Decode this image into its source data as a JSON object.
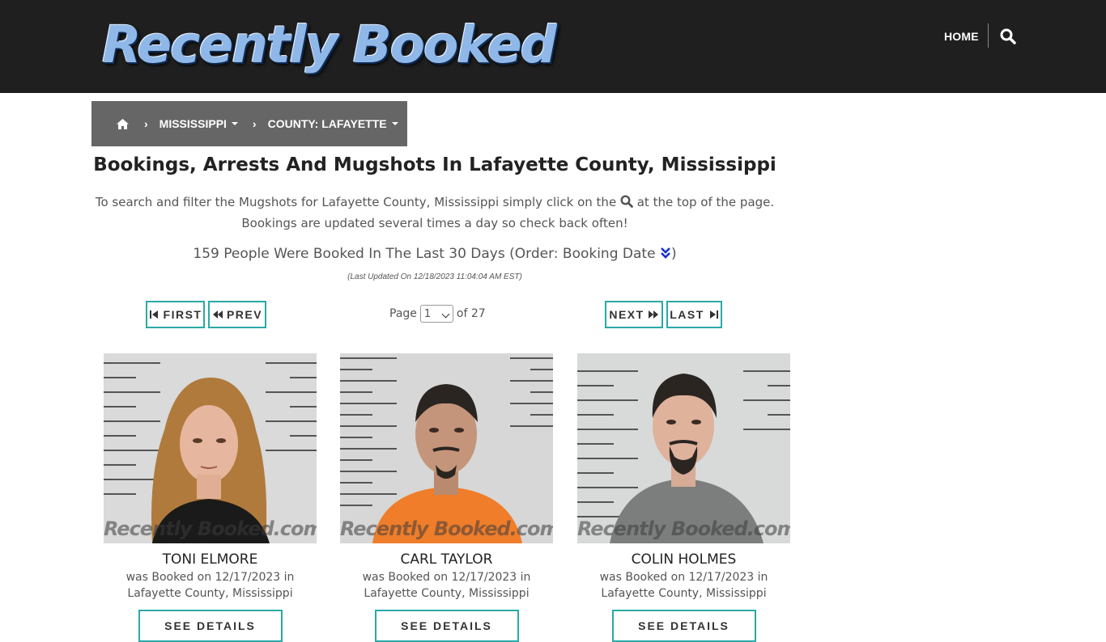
{
  "header": {
    "logo_text": "Recently Booked",
    "nav": {
      "home_label": "HOME"
    },
    "search_icon": "search-icon"
  },
  "breadcrumb": {
    "home_icon": "home-icon",
    "items": [
      {
        "label": "MISSISSIPPI"
      },
      {
        "label": "COUNTY: LAFAYETTE"
      }
    ]
  },
  "main": {
    "title": "Bookings, Arrests And Mugshots In Lafayette County, Mississippi",
    "intro_part1": "To search and filter the Mugshots for Lafayette County, Mississippi simply click on the",
    "intro_part2": "at the top of the page.",
    "intro_line2": "Bookings are updated several times a day so check back often!",
    "count_text": "159 People Were Booked In The Last 30 Days (Order: Booking Date",
    "count_close": ")",
    "updated": "(Last Updated On 12/18/2023 11:04:04 AM EST)"
  },
  "pagination": {
    "first_label": "FIRST",
    "prev_label": "PREV",
    "next_label": "NEXT",
    "last_label": "LAST",
    "page_label": "Page",
    "current_page": "1",
    "of_label": "of 27"
  },
  "watermark": "Recently Booked.com",
  "inmates": [
    {
      "name": "TONI ELMORE",
      "booked_line": "was Booked on 12/17/2023 in",
      "location": "Lafayette County, Mississippi",
      "details_label": "SEE DETAILS",
      "shirt_color": "#1a1a1a",
      "hair_color": "#b07a3c",
      "bg_color": "#d9dad9"
    },
    {
      "name": "CARL TAYLOR",
      "booked_line": "was Booked on 12/17/2023 in",
      "location": "Lafayette County, Mississippi",
      "details_label": "SEE DETAILS",
      "shirt_color": "#f07d2a",
      "hair_color": "#2a2520",
      "bg_color": "#d6d7d6"
    },
    {
      "name": "COLIN HOLMES",
      "booked_line": "was Booked on 12/17/2023 in",
      "location": "Lafayette County, Mississippi",
      "details_label": "SEE DETAILS",
      "shirt_color": "#7b7e7c",
      "hair_color": "#2b2522",
      "bg_color": "#d8d9d9"
    }
  ],
  "colors": {
    "topbar": "#1f1f1f",
    "breadcrumb_bg": "#666666",
    "accent_teal": "#2aa9a5",
    "order_icon": "#1530c8"
  }
}
